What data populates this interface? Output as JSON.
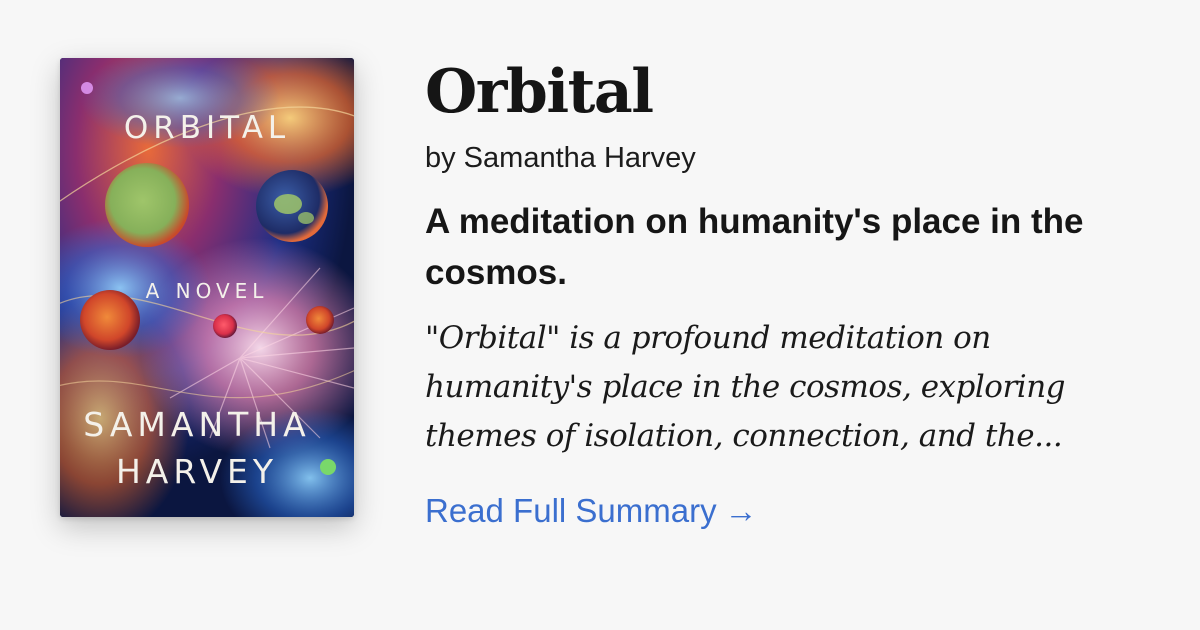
{
  "book": {
    "title": "Orbital",
    "author": "by Samantha Harvey",
    "tagline": "A meditation on humanity's place in the cosmos.",
    "summary": "\"Orbital\" is a profound meditation on humanity's place in the cosmos, exploring themes of isolation, connection, and the...",
    "read_link_label": "Read Full Summary",
    "read_link_arrow": "→"
  },
  "cover": {
    "title_text": "ORBITAL",
    "subtitle_text": "A NOVEL",
    "author_first": "SAMANTHA",
    "author_last": "HARVEY"
  },
  "colors": {
    "background": "#f7f7f7",
    "link": "#3b6fcf",
    "text": "#151515"
  }
}
